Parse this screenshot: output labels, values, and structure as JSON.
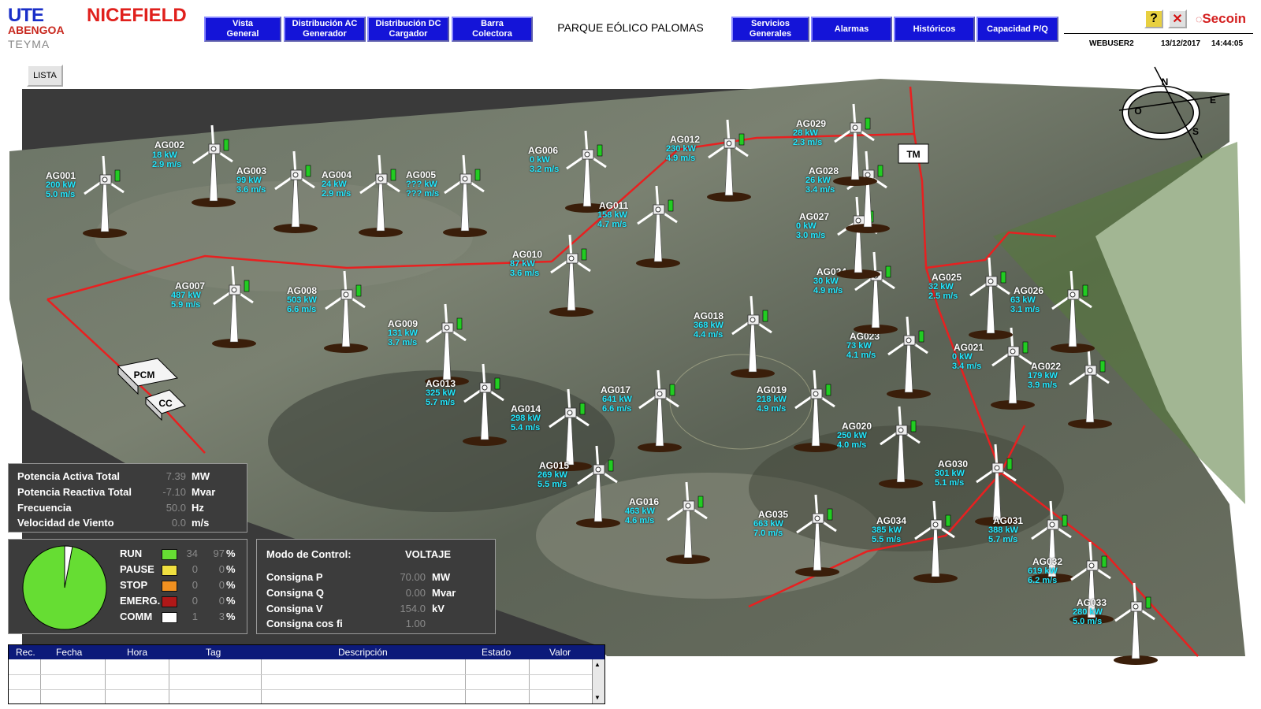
{
  "header": {
    "logo_ute": "UTE",
    "logo_nicefield": "NICEFIELD",
    "logo_abengoa": "ABENGOA",
    "logo_teyma": "TEYMA",
    "nav_left": [
      {
        "l1": "Vista",
        "l2": "General"
      },
      {
        "l1": "Distribución AC",
        "l2": "Generador"
      },
      {
        "l1": "Distribución DC",
        "l2": "Cargador"
      },
      {
        "l1": "Barra",
        "l2": "Colectora"
      }
    ],
    "title": "PARQUE EÓLICO PALOMAS",
    "nav_right": [
      {
        "l1": "Servicios",
        "l2": "Generales"
      },
      {
        "l1": "Alarmas",
        "l2": ""
      },
      {
        "l1": "Históricos",
        "l2": ""
      },
      {
        "l1": "Capacidad P/Q",
        "l2": ""
      }
    ],
    "help_glyph": "?",
    "close_glyph": "✕",
    "secoin": "Secoin",
    "user": "WEBUSER2",
    "date": "13/12/2017",
    "time": "14:44:05"
  },
  "lista": "LISTA",
  "compass": {
    "n": "N",
    "e": "E",
    "s": "S",
    "o": "O"
  },
  "buildings": {
    "tm": "TM",
    "pcm": "PCM",
    "cc": "CC"
  },
  "turbines": [
    {
      "name": "AG001",
      "kw": "200 kW",
      "ms": "5.0 m/s"
    },
    {
      "name": "AG002",
      "kw": "18 kW",
      "ms": "2.9 m/s"
    },
    {
      "name": "AG003",
      "kw": "99 kW",
      "ms": "3.6 m/s"
    },
    {
      "name": "AG004",
      "kw": "24 kW",
      "ms": "2.9 m/s"
    },
    {
      "name": "AG005",
      "kw": "??? kW",
      "ms": "??? m/s"
    },
    {
      "name": "AG006",
      "kw": "0 kW",
      "ms": "3.2 m/s"
    },
    {
      "name": "AG007",
      "kw": "487 kW",
      "ms": "5.9 m/s"
    },
    {
      "name": "AG008",
      "kw": "503 kW",
      "ms": "6.6 m/s"
    },
    {
      "name": "AG009",
      "kw": "131 kW",
      "ms": "3.7 m/s"
    },
    {
      "name": "AG010",
      "kw": "87 kW",
      "ms": "3.6 m/s"
    },
    {
      "name": "AG011",
      "kw": "158 kW",
      "ms": "4.7 m/s"
    },
    {
      "name": "AG012",
      "kw": "230 kW",
      "ms": "4.9 m/s"
    },
    {
      "name": "AG013",
      "kw": "325 kW",
      "ms": "5.7 m/s"
    },
    {
      "name": "AG014",
      "kw": "298 kW",
      "ms": "5.4 m/s"
    },
    {
      "name": "AG015",
      "kw": "269 kW",
      "ms": "5.5 m/s"
    },
    {
      "name": "AG016",
      "kw": "463 kW",
      "ms": "4.6 m/s"
    },
    {
      "name": "AG017",
      "kw": "641 kW",
      "ms": "6.6 m/s"
    },
    {
      "name": "AG018",
      "kw": "368 kW",
      "ms": "4.4 m/s"
    },
    {
      "name": "AG019",
      "kw": "218 kW",
      "ms": "4.9 m/s"
    },
    {
      "name": "AG020",
      "kw": "250 kW",
      "ms": "4.0 m/s"
    },
    {
      "name": "AG021",
      "kw": "0 kW",
      "ms": "3.4 m/s"
    },
    {
      "name": "AG022",
      "kw": "179 kW",
      "ms": "3.9 m/s"
    },
    {
      "name": "AG023",
      "kw": "73 kW",
      "ms": "4.1 m/s"
    },
    {
      "name": "AG024",
      "kw": "30 kW",
      "ms": "4.9 m/s"
    },
    {
      "name": "AG025",
      "kw": "32 kW",
      "ms": "2.5 m/s"
    },
    {
      "name": "AG026",
      "kw": "63 kW",
      "ms": "3.1 m/s"
    },
    {
      "name": "AG027",
      "kw": "0 kW",
      "ms": "3.0 m/s"
    },
    {
      "name": "AG028",
      "kw": "26 kW",
      "ms": "3.4 m/s"
    },
    {
      "name": "AG029",
      "kw": "28 kW",
      "ms": "2.3 m/s"
    },
    {
      "name": "AG030",
      "kw": "301 kW",
      "ms": "5.1 m/s"
    },
    {
      "name": "AG031",
      "kw": "388 kW",
      "ms": "5.7 m/s"
    },
    {
      "name": "AG032",
      "kw": "619 kW",
      "ms": "6.2 m/s"
    },
    {
      "name": "AG033",
      "kw": "280 kW",
      "ms": "5.0 m/s"
    },
    {
      "name": "AG034",
      "kw": "385 kW",
      "ms": "5.5 m/s"
    },
    {
      "name": "AG035",
      "kw": "663 kW",
      "ms": "7.0 m/s"
    }
  ],
  "totals": [
    {
      "label": "Potencia Activa Total",
      "value": "7.39",
      "unit": "MW"
    },
    {
      "label": "Potencia Reactiva Total",
      "value": "-7.10",
      "unit": "Mvar"
    },
    {
      "label": "Frecuencia",
      "value": "50.0",
      "unit": "Hz"
    },
    {
      "label": "Velocidad de Viento",
      "value": "0.0",
      "unit": "m/s"
    }
  ],
  "status": {
    "pie_run_fraction": 0.97,
    "pie_colors": {
      "run": "#66dd33",
      "comm": "#ffffff"
    },
    "items": [
      {
        "label": "RUN",
        "count": "34",
        "pct": "97",
        "color": "#66dd33"
      },
      {
        "label": "PAUSE",
        "count": "0",
        "pct": "0",
        "color": "#f0e040"
      },
      {
        "label": "STOP",
        "count": "0",
        "pct": "0",
        "color": "#f09020"
      },
      {
        "label": "EMERG.",
        "count": "0",
        "pct": "0",
        "color": "#b01818"
      },
      {
        "label": "COMM",
        "count": "1",
        "pct": "3",
        "color": "#ffffff"
      }
    ],
    "pct_sign": "%"
  },
  "control": {
    "mode_label": "Modo de Control:",
    "mode_value": "VOLTAJE",
    "rows": [
      {
        "label": "Consigna P",
        "value": "70.00",
        "unit": "MW"
      },
      {
        "label": "Consigna Q",
        "value": "0.00",
        "unit": "Mvar"
      },
      {
        "label": "Consigna V",
        "value": "154.0",
        "unit": "kV"
      },
      {
        "label": "Consigna cos fi",
        "value": "1.00",
        "unit": ""
      }
    ]
  },
  "events": {
    "columns": [
      "Rec.",
      "Fecha",
      "Hora",
      "Tag",
      "Descripción",
      "Estado",
      "Valor"
    ]
  }
}
